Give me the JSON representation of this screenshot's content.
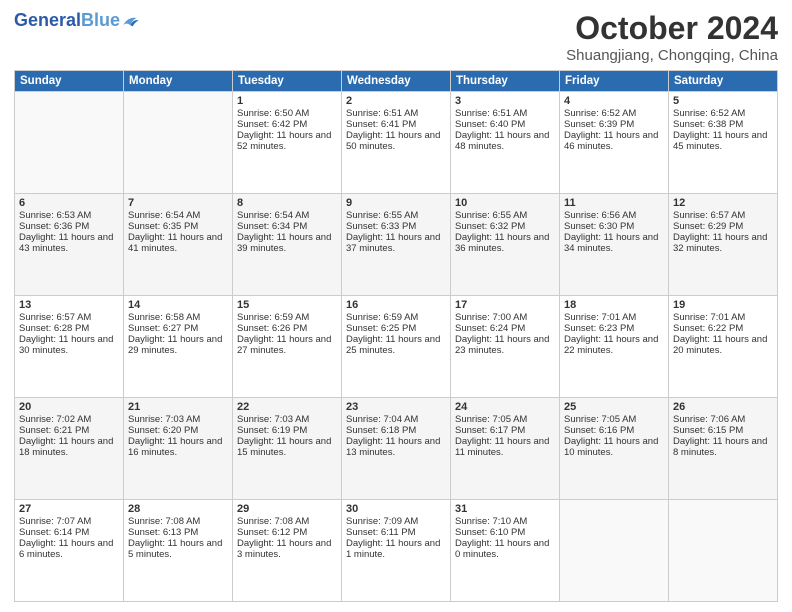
{
  "logo": {
    "text_general": "General",
    "text_blue": "Blue"
  },
  "title": "October 2024",
  "subtitle": "Shuangjiang, Chongqing, China",
  "days_header": [
    "Sunday",
    "Monday",
    "Tuesday",
    "Wednesday",
    "Thursday",
    "Friday",
    "Saturday"
  ],
  "weeks": [
    [
      {
        "num": "",
        "text": ""
      },
      {
        "num": "",
        "text": ""
      },
      {
        "num": "1",
        "text": "Sunrise: 6:50 AM\nSunset: 6:42 PM\nDaylight: 11 hours and 52 minutes."
      },
      {
        "num": "2",
        "text": "Sunrise: 6:51 AM\nSunset: 6:41 PM\nDaylight: 11 hours and 50 minutes."
      },
      {
        "num": "3",
        "text": "Sunrise: 6:51 AM\nSunset: 6:40 PM\nDaylight: 11 hours and 48 minutes."
      },
      {
        "num": "4",
        "text": "Sunrise: 6:52 AM\nSunset: 6:39 PM\nDaylight: 11 hours and 46 minutes."
      },
      {
        "num": "5",
        "text": "Sunrise: 6:52 AM\nSunset: 6:38 PM\nDaylight: 11 hours and 45 minutes."
      }
    ],
    [
      {
        "num": "6",
        "text": "Sunrise: 6:53 AM\nSunset: 6:36 PM\nDaylight: 11 hours and 43 minutes."
      },
      {
        "num": "7",
        "text": "Sunrise: 6:54 AM\nSunset: 6:35 PM\nDaylight: 11 hours and 41 minutes."
      },
      {
        "num": "8",
        "text": "Sunrise: 6:54 AM\nSunset: 6:34 PM\nDaylight: 11 hours and 39 minutes."
      },
      {
        "num": "9",
        "text": "Sunrise: 6:55 AM\nSunset: 6:33 PM\nDaylight: 11 hours and 37 minutes."
      },
      {
        "num": "10",
        "text": "Sunrise: 6:55 AM\nSunset: 6:32 PM\nDaylight: 11 hours and 36 minutes."
      },
      {
        "num": "11",
        "text": "Sunrise: 6:56 AM\nSunset: 6:30 PM\nDaylight: 11 hours and 34 minutes."
      },
      {
        "num": "12",
        "text": "Sunrise: 6:57 AM\nSunset: 6:29 PM\nDaylight: 11 hours and 32 minutes."
      }
    ],
    [
      {
        "num": "13",
        "text": "Sunrise: 6:57 AM\nSunset: 6:28 PM\nDaylight: 11 hours and 30 minutes."
      },
      {
        "num": "14",
        "text": "Sunrise: 6:58 AM\nSunset: 6:27 PM\nDaylight: 11 hours and 29 minutes."
      },
      {
        "num": "15",
        "text": "Sunrise: 6:59 AM\nSunset: 6:26 PM\nDaylight: 11 hours and 27 minutes."
      },
      {
        "num": "16",
        "text": "Sunrise: 6:59 AM\nSunset: 6:25 PM\nDaylight: 11 hours and 25 minutes."
      },
      {
        "num": "17",
        "text": "Sunrise: 7:00 AM\nSunset: 6:24 PM\nDaylight: 11 hours and 23 minutes."
      },
      {
        "num": "18",
        "text": "Sunrise: 7:01 AM\nSunset: 6:23 PM\nDaylight: 11 hours and 22 minutes."
      },
      {
        "num": "19",
        "text": "Sunrise: 7:01 AM\nSunset: 6:22 PM\nDaylight: 11 hours and 20 minutes."
      }
    ],
    [
      {
        "num": "20",
        "text": "Sunrise: 7:02 AM\nSunset: 6:21 PM\nDaylight: 11 hours and 18 minutes."
      },
      {
        "num": "21",
        "text": "Sunrise: 7:03 AM\nSunset: 6:20 PM\nDaylight: 11 hours and 16 minutes."
      },
      {
        "num": "22",
        "text": "Sunrise: 7:03 AM\nSunset: 6:19 PM\nDaylight: 11 hours and 15 minutes."
      },
      {
        "num": "23",
        "text": "Sunrise: 7:04 AM\nSunset: 6:18 PM\nDaylight: 11 hours and 13 minutes."
      },
      {
        "num": "24",
        "text": "Sunrise: 7:05 AM\nSunset: 6:17 PM\nDaylight: 11 hours and 11 minutes."
      },
      {
        "num": "25",
        "text": "Sunrise: 7:05 AM\nSunset: 6:16 PM\nDaylight: 11 hours and 10 minutes."
      },
      {
        "num": "26",
        "text": "Sunrise: 7:06 AM\nSunset: 6:15 PM\nDaylight: 11 hours and 8 minutes."
      }
    ],
    [
      {
        "num": "27",
        "text": "Sunrise: 7:07 AM\nSunset: 6:14 PM\nDaylight: 11 hours and 6 minutes."
      },
      {
        "num": "28",
        "text": "Sunrise: 7:08 AM\nSunset: 6:13 PM\nDaylight: 11 hours and 5 minutes."
      },
      {
        "num": "29",
        "text": "Sunrise: 7:08 AM\nSunset: 6:12 PM\nDaylight: 11 hours and 3 minutes."
      },
      {
        "num": "30",
        "text": "Sunrise: 7:09 AM\nSunset: 6:11 PM\nDaylight: 11 hours and 1 minute."
      },
      {
        "num": "31",
        "text": "Sunrise: 7:10 AM\nSunset: 6:10 PM\nDaylight: 11 hours and 0 minutes."
      },
      {
        "num": "",
        "text": ""
      },
      {
        "num": "",
        "text": ""
      }
    ]
  ]
}
